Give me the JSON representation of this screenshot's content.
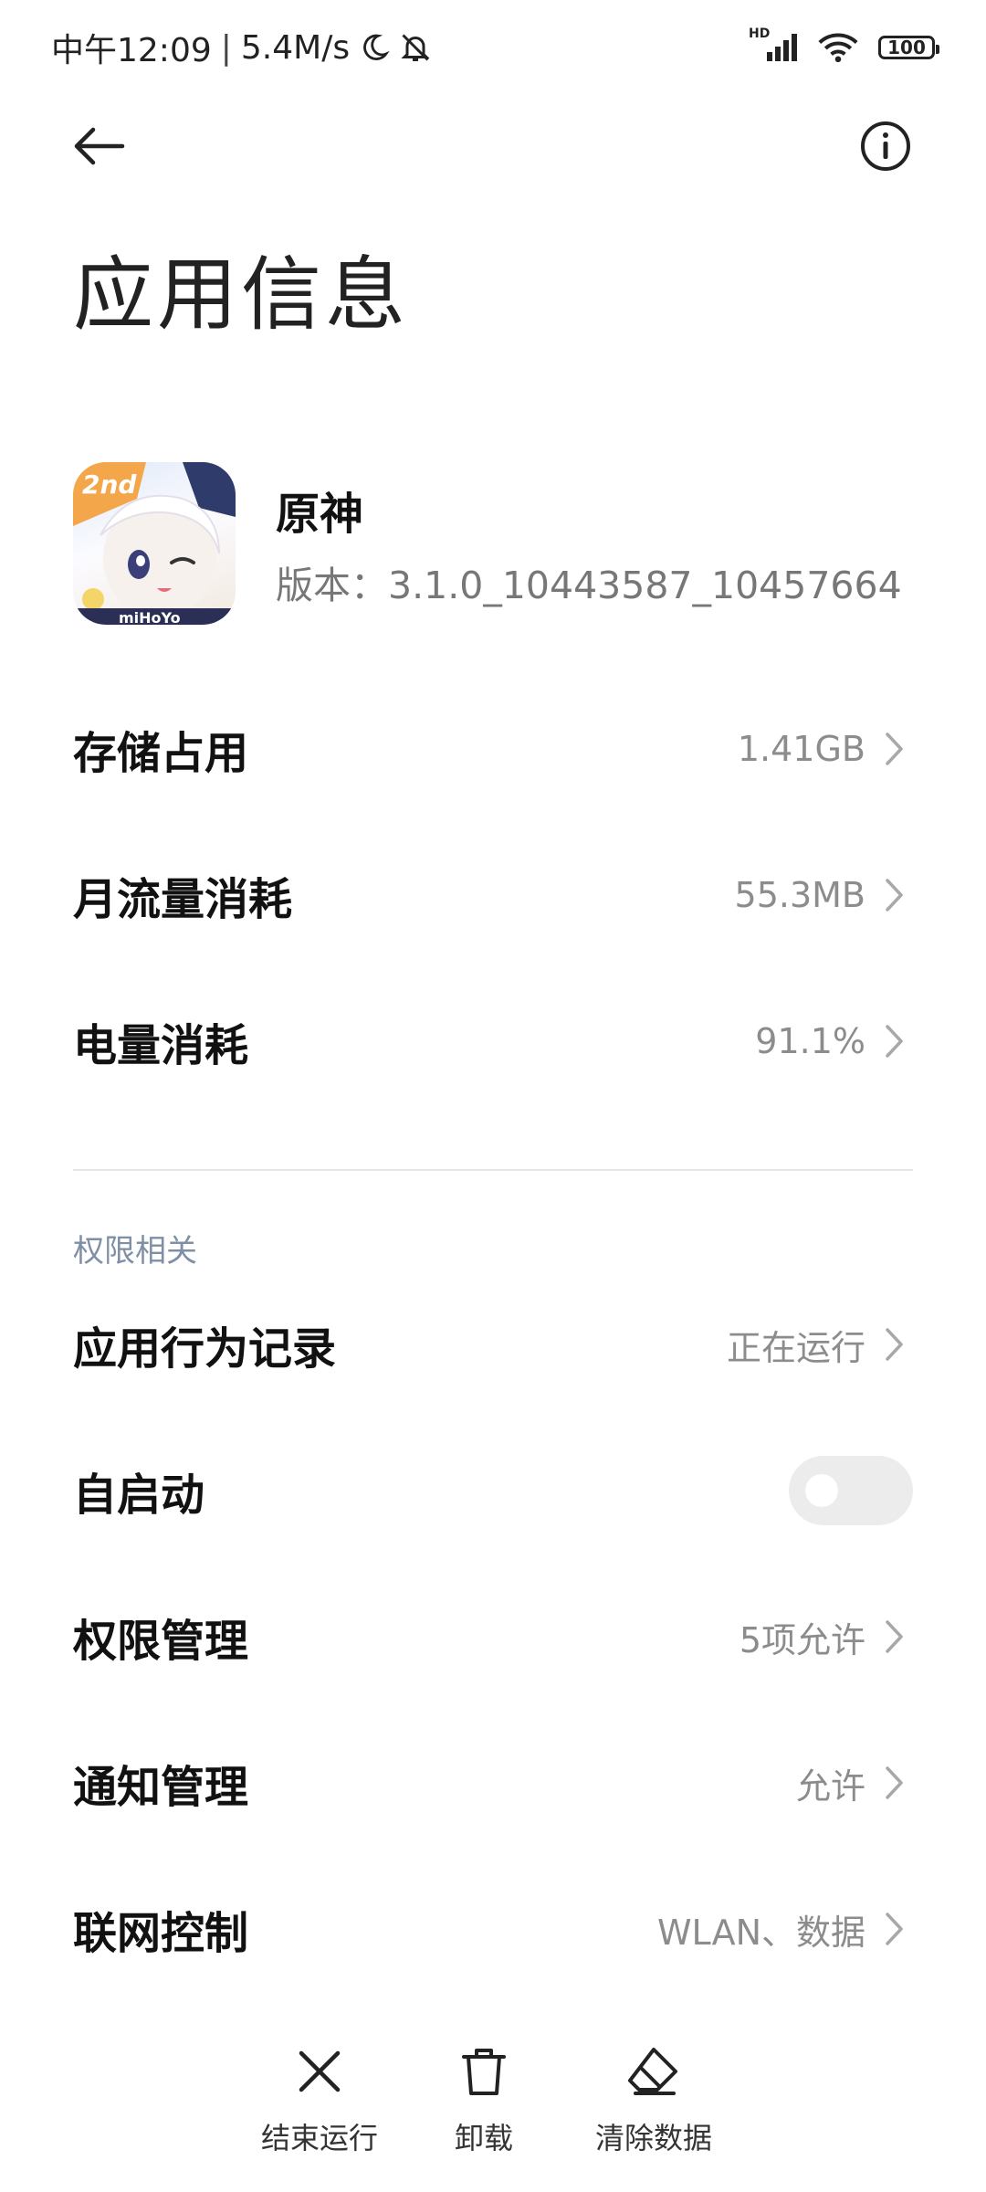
{
  "status_bar": {
    "time": "中午12:09",
    "separator": "|",
    "speed": "5.4M/s",
    "network_badge": "HD",
    "battery": "100"
  },
  "page": {
    "title": "应用信息"
  },
  "app": {
    "name": "原神",
    "version": "版本：3.1.0_10443587_10457664",
    "icon_badge": "2nd",
    "icon_brand": "miHoYo"
  },
  "rows": {
    "storage": {
      "label": "存储占用",
      "value": "1.41GB"
    },
    "data": {
      "label": "月流量消耗",
      "value": "55.3MB"
    },
    "battery": {
      "label": "电量消耗",
      "value": "91.1%"
    }
  },
  "permissions_section": {
    "header": "权限相关",
    "behavior": {
      "label": "应用行为记录",
      "value": "正在运行"
    },
    "autostart": {
      "label": "自启动",
      "enabled": false
    },
    "permission_mgmt": {
      "label": "权限管理",
      "value": "5项允许"
    },
    "notification_mgmt": {
      "label": "通知管理",
      "value": "允许"
    },
    "network_control": {
      "label": "联网控制",
      "value": "WLAN、数据"
    }
  },
  "actions": {
    "force_stop": "结束运行",
    "uninstall": "卸载",
    "clear_data": "清除数据"
  },
  "colors": {
    "section_header": "#7f8fa6",
    "value_text": "#8c8c8c",
    "toggle_off": "#ececec"
  }
}
